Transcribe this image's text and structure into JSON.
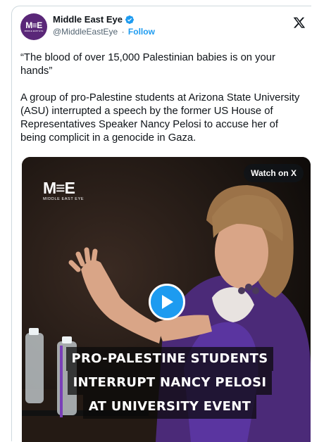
{
  "author": {
    "display_name": "Middle East Eye",
    "handle": "@MiddleEastEye",
    "separator": "·",
    "follow_label": "Follow",
    "avatar_mark": "M≡E",
    "avatar_subtitle": "MIDDLE EAST EYE"
  },
  "tweet": {
    "paragraphs": [
      "“The blood of over 15,000 Palestinian babies is on your hands”",
      "A group of pro-Palestine students at Arizona State University (ASU) interrupted a speech by the former US House of Representatives Speaker Nancy Pelosi to accuse her of being complicit in a genocide in Gaza."
    ]
  },
  "media": {
    "watch_label": "Watch on X",
    "logo_mark": "M≡E",
    "logo_subtitle": "MIDDLE EAST EYE",
    "caption_lines": [
      "PRO-PALESTINE STUDENTS",
      "INTERRUPT NANCY PELOSI",
      "AT UNIVERSITY EVENT"
    ]
  },
  "colors": {
    "brand_purple": "#5a2778",
    "link_blue": "#1d9bf0",
    "caption_accent": "#7a3fb8"
  },
  "icons": {
    "verified": "verified-badge-icon",
    "platform": "x-logo-icon",
    "play": "play-icon"
  }
}
